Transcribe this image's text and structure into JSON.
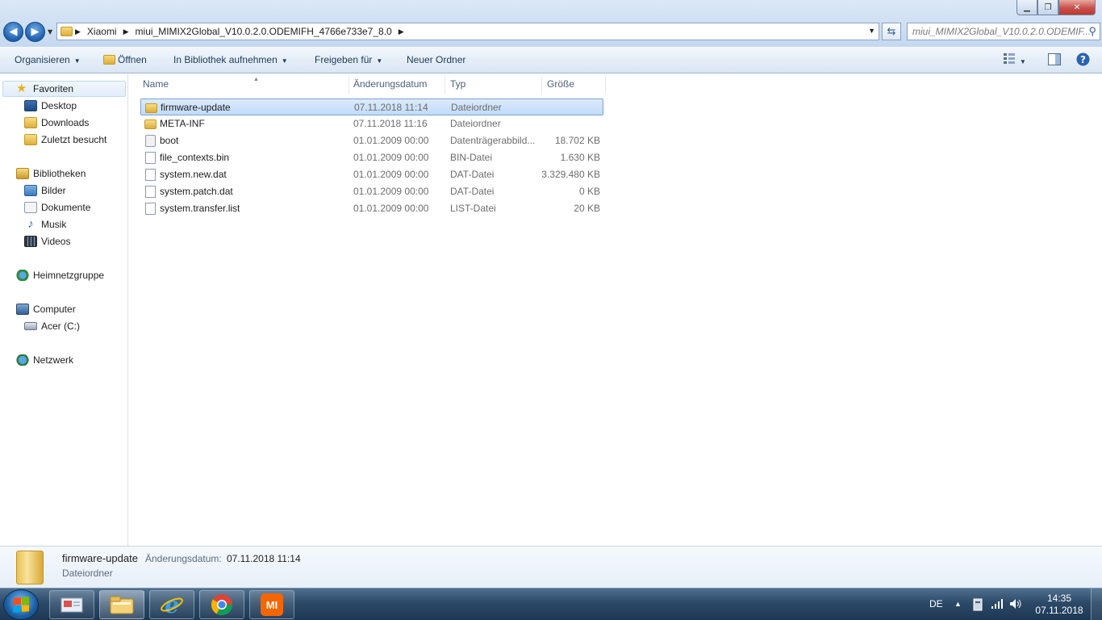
{
  "window": {
    "controls": {
      "minimize": "▁",
      "maximize": "❐",
      "close": "✕"
    }
  },
  "address": {
    "segments": [
      "Xiaomi",
      "miui_MIMIX2Global_V10.0.2.0.ODEMIFH_4766e733e7_8.0"
    ],
    "search_placeholder": "miui_MIMIX2Global_V10.0.2.0.ODEMIF..."
  },
  "toolbar": {
    "organize": "Organisieren",
    "open": "Öffnen",
    "library": "In Bibliothek aufnehmen",
    "share": "Freigeben für",
    "new_folder": "Neuer Ordner"
  },
  "sidebar": {
    "favorites": "Favoriten",
    "favorites_items": [
      "Desktop",
      "Downloads",
      "Zuletzt besucht"
    ],
    "libraries": "Bibliotheken",
    "libraries_items": [
      "Bilder",
      "Dokumente",
      "Musik",
      "Videos"
    ],
    "homegroup": "Heimnetzgruppe",
    "computer": "Computer",
    "computer_items": [
      "Acer (C:)"
    ],
    "network": "Netzwerk"
  },
  "columns": {
    "name": "Name",
    "date": "Änderungsdatum",
    "type": "Typ",
    "size": "Größe"
  },
  "files": [
    {
      "name": "firmware-update",
      "date": "07.11.2018 11:14",
      "type": "Dateiordner",
      "size": "",
      "icon": "folder"
    },
    {
      "name": "META-INF",
      "date": "07.11.2018 11:16",
      "type": "Dateiordner",
      "size": "",
      "icon": "folder"
    },
    {
      "name": "boot",
      "date": "01.01.2009 00:00",
      "type": "Datenträgerabbild...",
      "size": "18.702 KB",
      "icon": "disk-image"
    },
    {
      "name": "file_contexts.bin",
      "date": "01.01.2009 00:00",
      "type": "BIN-Datei",
      "size": "1.630 KB",
      "icon": "file"
    },
    {
      "name": "system.new.dat",
      "date": "01.01.2009 00:00",
      "type": "DAT-Datei",
      "size": "3.329.480 KB",
      "icon": "file"
    },
    {
      "name": "system.patch.dat",
      "date": "01.01.2009 00:00",
      "type": "DAT-Datei",
      "size": "0 KB",
      "icon": "file"
    },
    {
      "name": "system.transfer.list",
      "date": "01.01.2009 00:00",
      "type": "LIST-Datei",
      "size": "20 KB",
      "icon": "file"
    }
  ],
  "details": {
    "name": "firmware-update",
    "date_label": "Änderungsdatum:",
    "date_value": "07.11.2018 11:14",
    "type": "Dateiordner"
  },
  "taskbar": {
    "language": "DE",
    "time": "14:35",
    "date": "07.11.2018",
    "mi_label": "MI"
  },
  "colors": {
    "selection": "#cce8ff",
    "accent": "#1f5fae"
  }
}
